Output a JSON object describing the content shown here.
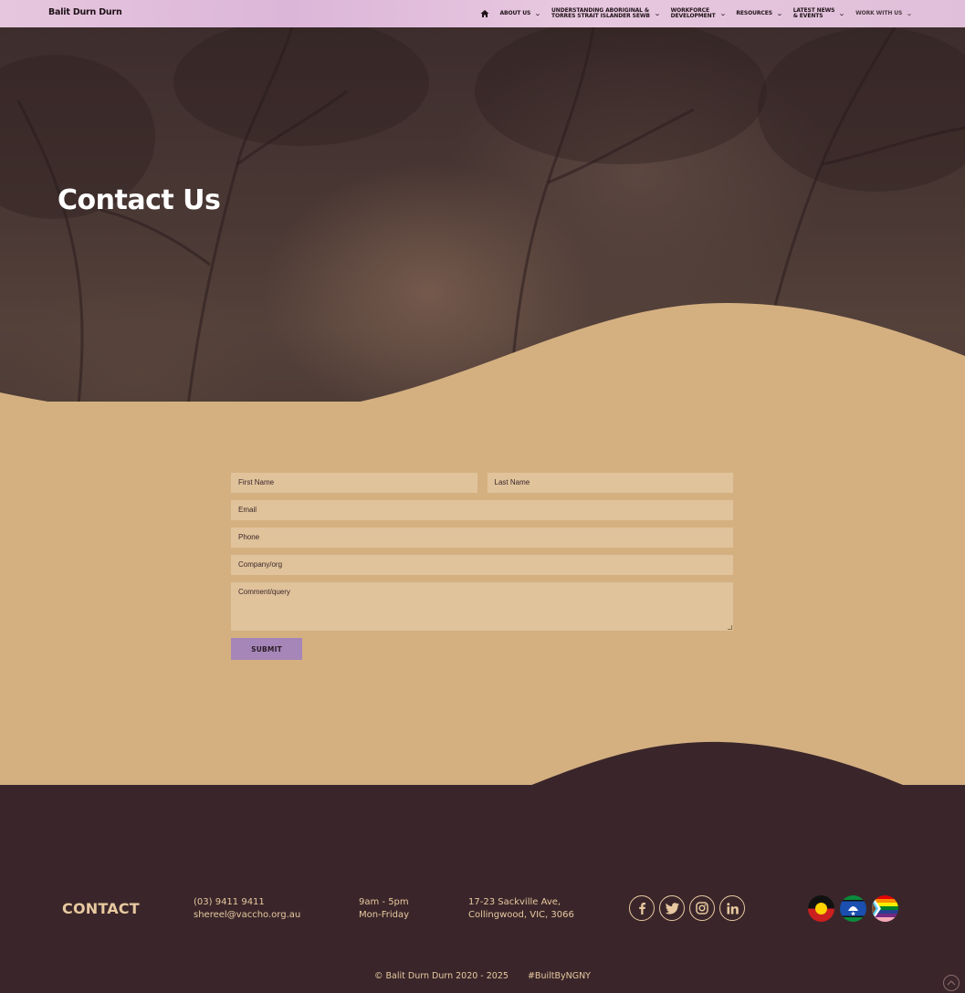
{
  "nav": {
    "brand": "Balit Durn Durn",
    "items": [
      {
        "label": "ABOUT US",
        "icon": "chevron-down-icon"
      },
      {
        "label": "UNDERSTANDING ABORIGINAL & TORRES STRAIT ISLANDER SEWB",
        "line1": "UNDERSTANDING ABORIGINAL &",
        "line2": "TORRES STRAIT ISLANDER SEWB",
        "icon": "chevron-down-icon"
      },
      {
        "label": "WORKFORCE DEVELOPMENT",
        "line1": "WORKFORCE",
        "line2": "DEVELOPMENT",
        "icon": "chevron-down-icon"
      },
      {
        "label": "RESOURCES",
        "icon": "chevron-down-icon"
      },
      {
        "label": "LATEST NEWS & EVENTS",
        "line1": "LATEST NEWS",
        "line2": "& EVENTS",
        "icon": "chevron-down-icon"
      },
      {
        "label": "WORK WITH US",
        "icon": "chevron-down-icon"
      }
    ],
    "home_icon": "home-icon"
  },
  "hero": {
    "title": "Contact Us"
  },
  "form": {
    "first_name_placeholder": "First Name",
    "last_name_placeholder": "Last Name",
    "email_placeholder": "Email",
    "phone_placeholder": "Phone",
    "company_placeholder": "Company/org",
    "comment_placeholder": "Comment/query",
    "submit_label": "SUBMIT"
  },
  "footer": {
    "heading": "CONTACT",
    "phone": "(03) 9411 9411",
    "email": "shereel@vaccho.org.au",
    "hours_time": "9am - 5pm",
    "hours_days": "Mon-Friday",
    "address_line1": "17-23 Sackville Ave,",
    "address_line2": "Collingwood, VIC, 3066",
    "socials": [
      "facebook-icon",
      "twitter-icon",
      "instagram-icon",
      "linkedin-icon"
    ],
    "flags": [
      "aboriginal-flag-icon",
      "torres-strait-islander-flag-icon",
      "pride-flag-icon"
    ],
    "copyright": "© Balit Durn Durn 2020 - 2025",
    "built_by": "#BuiltByNGNY"
  },
  "colors": {
    "sand": "#d4b081",
    "field": "#e0c39b",
    "dark": "#3a262a",
    "accent_text": "#e8c9a0",
    "submit": "#a686b8",
    "nav": "#dcb6d8"
  }
}
